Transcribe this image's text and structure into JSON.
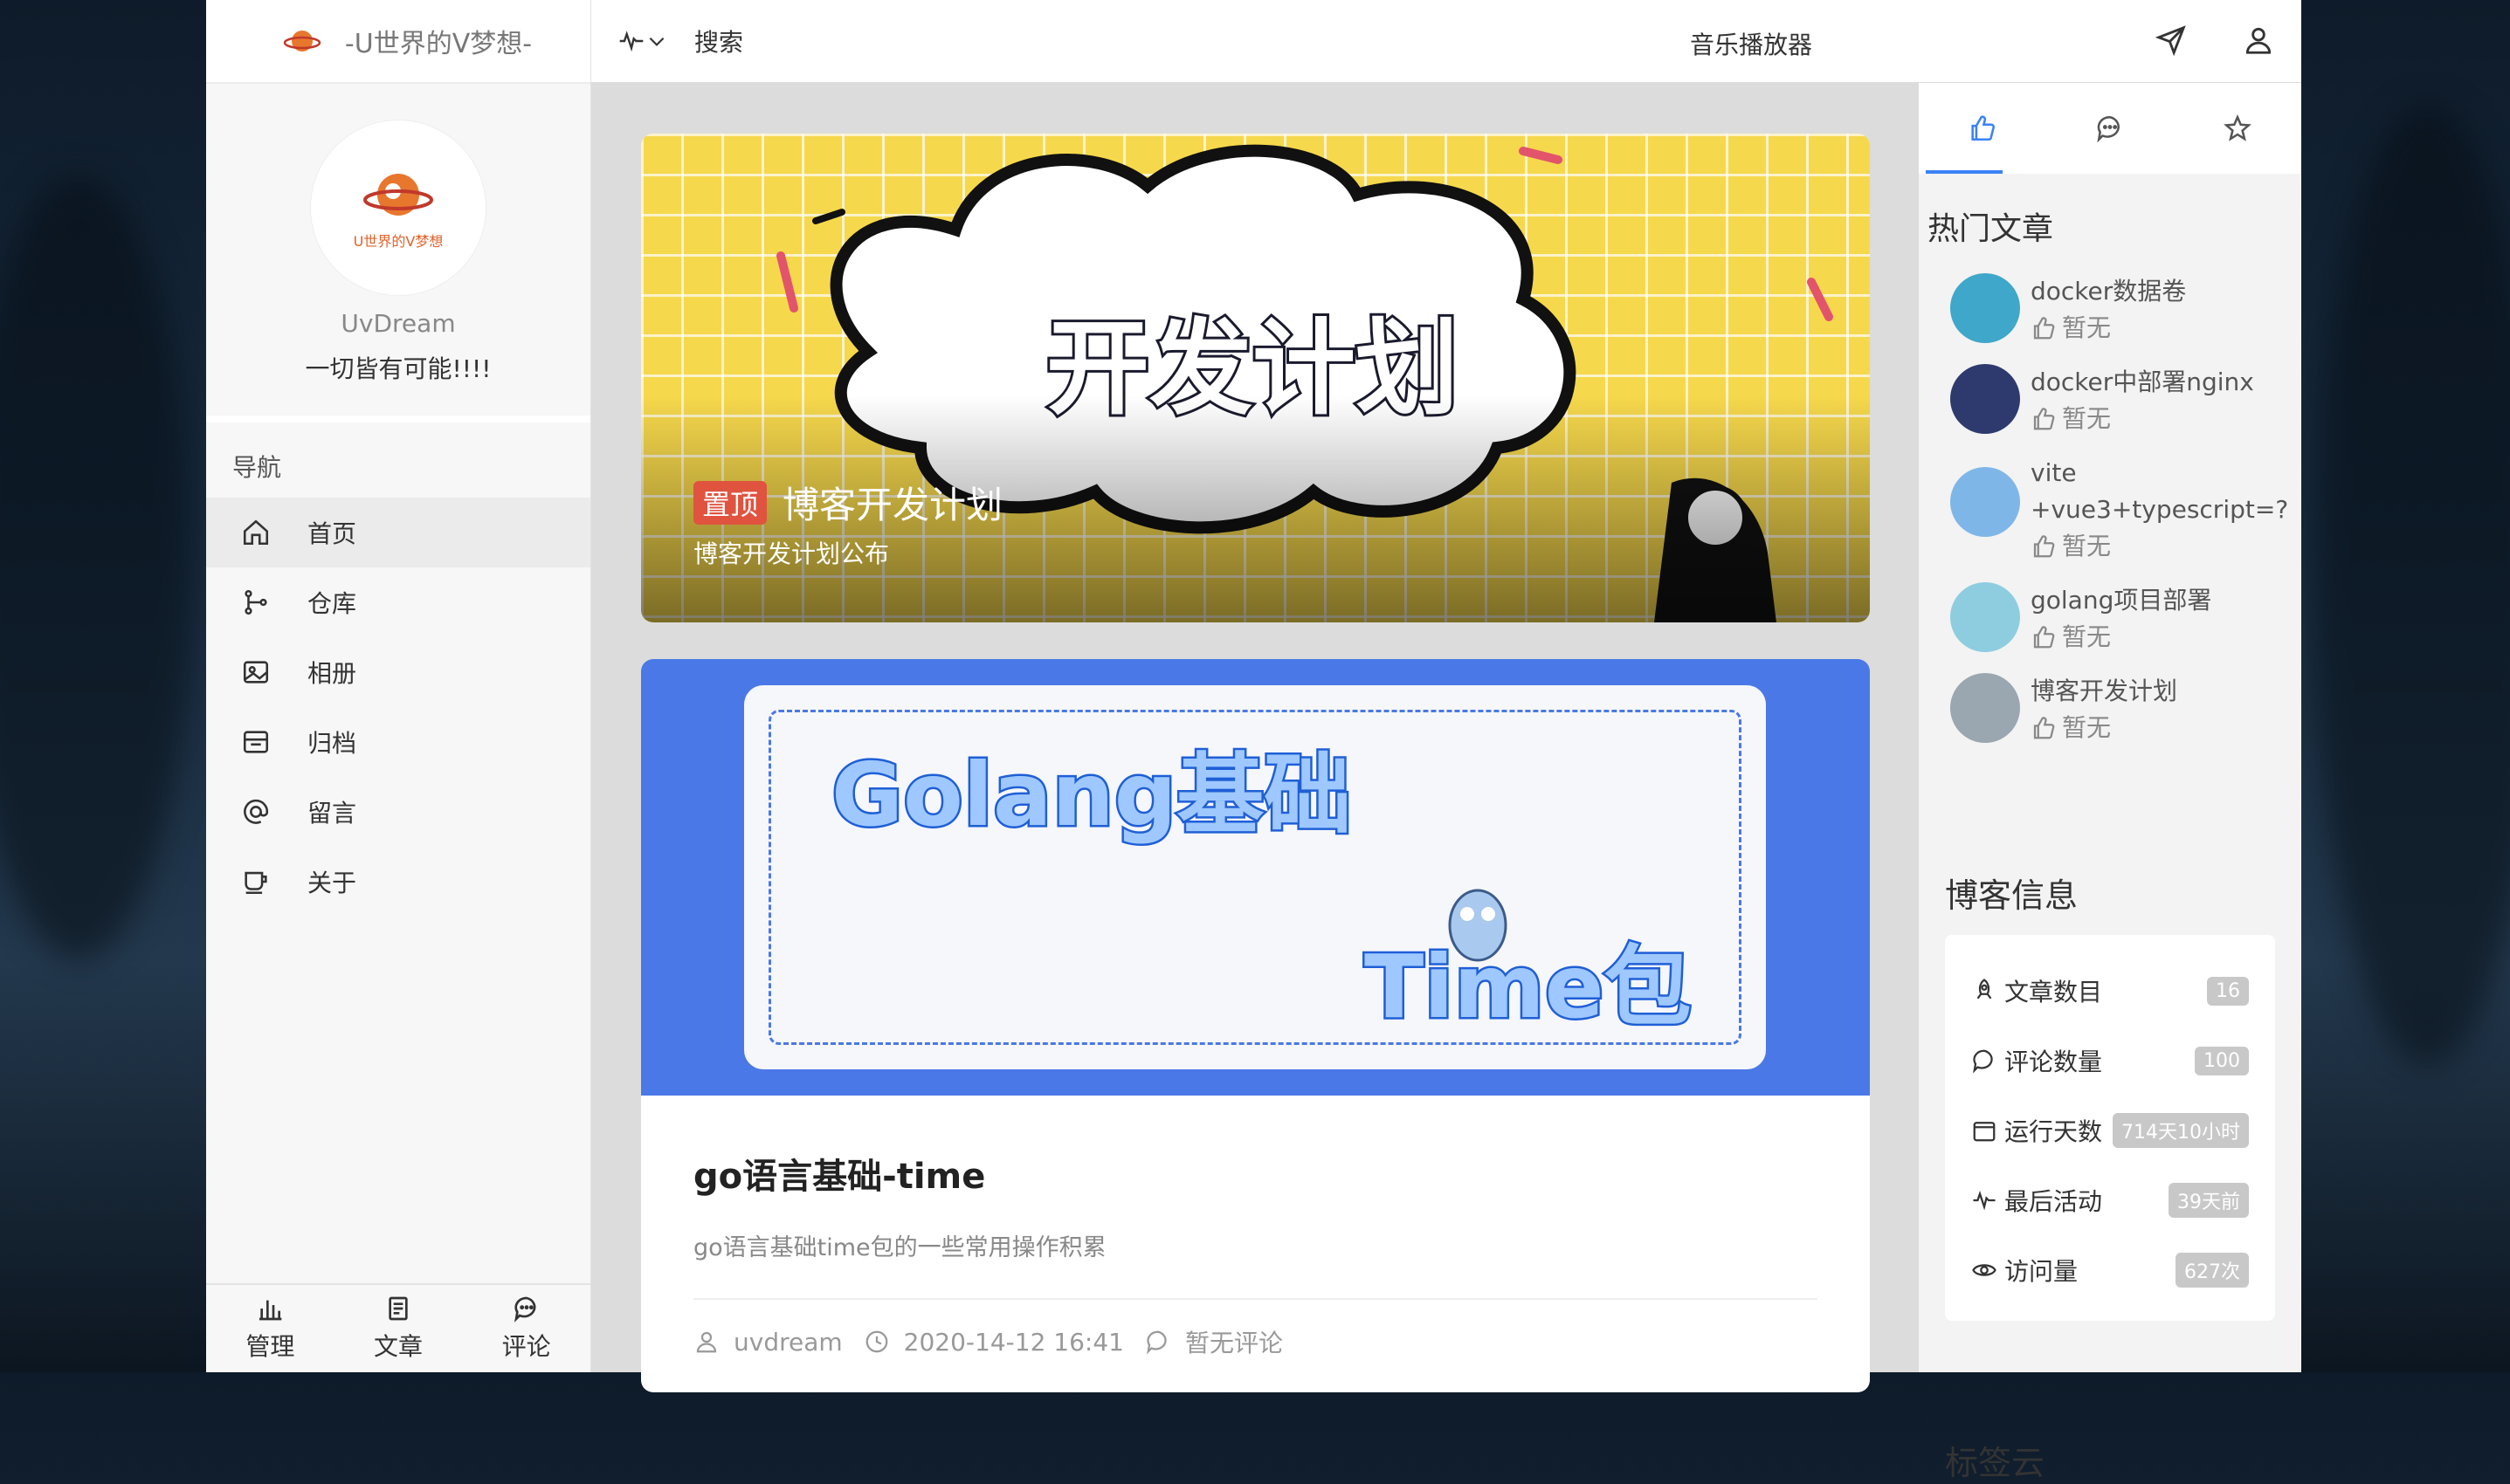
{
  "site": {
    "title": "-U世界的V梦想-",
    "logo_caption": "U世界的V梦想"
  },
  "profile": {
    "username": "UvDream",
    "motto": "一切皆有可能!!!!"
  },
  "nav": {
    "heading": "导航",
    "items": [
      {
        "label": "首页",
        "icon": "home-icon",
        "active": true
      },
      {
        "label": "仓库",
        "icon": "git-branch-icon"
      },
      {
        "label": "相册",
        "icon": "image-icon"
      },
      {
        "label": "归档",
        "icon": "archive-icon"
      },
      {
        "label": "留言",
        "icon": "at-icon"
      },
      {
        "label": "关于",
        "icon": "cup-icon"
      }
    ]
  },
  "sidebar_bottom": [
    {
      "label": "管理",
      "icon": "bar-chart-icon"
    },
    {
      "label": "文章",
      "icon": "document-icon"
    },
    {
      "label": "评论",
      "icon": "comment-icon"
    }
  ],
  "topbar": {
    "search_label": "搜索",
    "music_label": "音乐播放器",
    "icons": [
      "pulse-icon",
      "chevron-down-icon",
      "send-icon",
      "user-icon"
    ]
  },
  "featured": {
    "badge": "置顶",
    "title": "博客开发计划",
    "description": "博客开发计划公布",
    "cover_text": "开发计划"
  },
  "post": {
    "cover_text_1": "Golang基础",
    "cover_text_2": "Time包",
    "title": "go语言基础-time",
    "description": "go语言基础time包的一些常用操作积累",
    "author": "uvdream",
    "date": "2020-14-12 16:41",
    "comments": "暂无评论"
  },
  "right_panel": {
    "tabs": [
      "thumbs-up-icon",
      "chat-bubble-icon",
      "star-icon"
    ],
    "hot_heading": "热门文章",
    "hot_articles": [
      {
        "title": "docker数据卷",
        "likes": "暂无",
        "color": "#3fa7c9"
      },
      {
        "title": "docker中部署nginx",
        "likes": "暂无",
        "color": "#2e3a6e"
      },
      {
        "title": "vite +vue3+typescript=?",
        "likes": "暂无",
        "color": "#7fb6e8"
      },
      {
        "title": "golang项目部署",
        "likes": "暂无",
        "color": "#8ecde0"
      },
      {
        "title": "博客开发计划",
        "likes": "暂无",
        "color": "#9aa6b0"
      }
    ],
    "info_heading": "博客信息",
    "info": [
      {
        "label": "文章数目",
        "value": "16",
        "icon": "rocket-icon"
      },
      {
        "label": "评论数量",
        "value": "100",
        "icon": "comment-icon"
      },
      {
        "label": "运行天数",
        "value": "714天10小时",
        "icon": "calendar-icon"
      },
      {
        "label": "最后活动",
        "value": "39天前",
        "icon": "pulse-icon"
      },
      {
        "label": "访问量",
        "value": "627次",
        "icon": "eye-icon"
      }
    ],
    "tags_heading": "标签云"
  },
  "colors": {
    "accent": "#3b82f6",
    "pin_badge": "#e0533f",
    "yellow_cover": "#f6d84c",
    "blue_cover": "#4a78e6"
  }
}
